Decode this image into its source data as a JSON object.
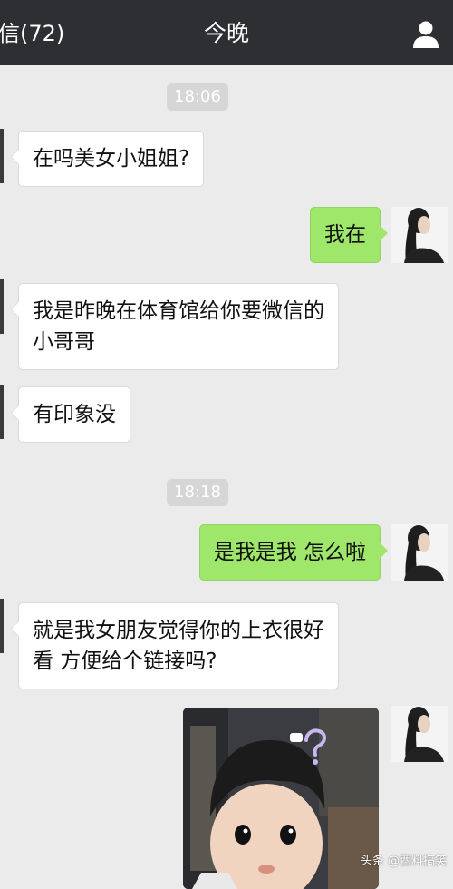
{
  "navbar": {
    "back_label": "信(72)",
    "title": "今晚"
  },
  "messages": {
    "time_1": "18:06",
    "m1": "在吗美女小姐姐?",
    "m2": "我在",
    "m3_line1": "我是昨晚在体育馆给你要微信的",
    "m3_line2": "小哥哥",
    "m4": "有印象没",
    "time_2": "18:18",
    "m5": "是我是我  怎么啦",
    "m6_line1": "就是我女朋友觉得你的上衣很好",
    "m6_line2": "看  方便给个链接吗?"
  },
  "watermark": "头条 @酉料搞笑",
  "colors": {
    "navbar": "#2e2f33",
    "chat_background": "#ebebeb",
    "sent_bubble": "#9fe76a",
    "received_bubble": "#ffffff"
  },
  "icons": {
    "profile": "person-icon"
  }
}
